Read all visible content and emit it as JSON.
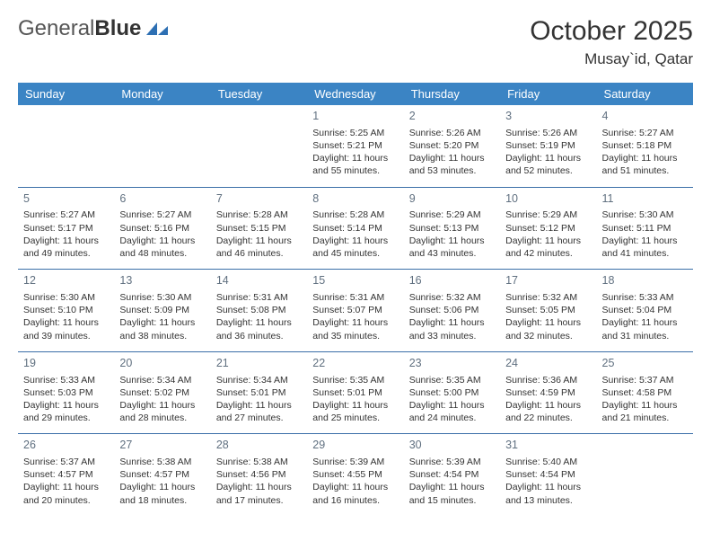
{
  "logo": {
    "word1": "General",
    "word2": "Blue"
  },
  "title": "October 2025",
  "location": "Musay`id, Qatar",
  "dayHeaders": [
    "Sunday",
    "Monday",
    "Tuesday",
    "Wednesday",
    "Thursday",
    "Friday",
    "Saturday"
  ],
  "weeks": [
    [
      null,
      null,
      null,
      {
        "n": "1",
        "sr": "5:25 AM",
        "ss": "5:21 PM",
        "dh": "11",
        "dm": "55"
      },
      {
        "n": "2",
        "sr": "5:26 AM",
        "ss": "5:20 PM",
        "dh": "11",
        "dm": "53"
      },
      {
        "n": "3",
        "sr": "5:26 AM",
        "ss": "5:19 PM",
        "dh": "11",
        "dm": "52"
      },
      {
        "n": "4",
        "sr": "5:27 AM",
        "ss": "5:18 PM",
        "dh": "11",
        "dm": "51"
      }
    ],
    [
      {
        "n": "5",
        "sr": "5:27 AM",
        "ss": "5:17 PM",
        "dh": "11",
        "dm": "49"
      },
      {
        "n": "6",
        "sr": "5:27 AM",
        "ss": "5:16 PM",
        "dh": "11",
        "dm": "48"
      },
      {
        "n": "7",
        "sr": "5:28 AM",
        "ss": "5:15 PM",
        "dh": "11",
        "dm": "46"
      },
      {
        "n": "8",
        "sr": "5:28 AM",
        "ss": "5:14 PM",
        "dh": "11",
        "dm": "45"
      },
      {
        "n": "9",
        "sr": "5:29 AM",
        "ss": "5:13 PM",
        "dh": "11",
        "dm": "43"
      },
      {
        "n": "10",
        "sr": "5:29 AM",
        "ss": "5:12 PM",
        "dh": "11",
        "dm": "42"
      },
      {
        "n": "11",
        "sr": "5:30 AM",
        "ss": "5:11 PM",
        "dh": "11",
        "dm": "41"
      }
    ],
    [
      {
        "n": "12",
        "sr": "5:30 AM",
        "ss": "5:10 PM",
        "dh": "11",
        "dm": "39"
      },
      {
        "n": "13",
        "sr": "5:30 AM",
        "ss": "5:09 PM",
        "dh": "11",
        "dm": "38"
      },
      {
        "n": "14",
        "sr": "5:31 AM",
        "ss": "5:08 PM",
        "dh": "11",
        "dm": "36"
      },
      {
        "n": "15",
        "sr": "5:31 AM",
        "ss": "5:07 PM",
        "dh": "11",
        "dm": "35"
      },
      {
        "n": "16",
        "sr": "5:32 AM",
        "ss": "5:06 PM",
        "dh": "11",
        "dm": "33"
      },
      {
        "n": "17",
        "sr": "5:32 AM",
        "ss": "5:05 PM",
        "dh": "11",
        "dm": "32"
      },
      {
        "n": "18",
        "sr": "5:33 AM",
        "ss": "5:04 PM",
        "dh": "11",
        "dm": "31"
      }
    ],
    [
      {
        "n": "19",
        "sr": "5:33 AM",
        "ss": "5:03 PM",
        "dh": "11",
        "dm": "29"
      },
      {
        "n": "20",
        "sr": "5:34 AM",
        "ss": "5:02 PM",
        "dh": "11",
        "dm": "28"
      },
      {
        "n": "21",
        "sr": "5:34 AM",
        "ss": "5:01 PM",
        "dh": "11",
        "dm": "27"
      },
      {
        "n": "22",
        "sr": "5:35 AM",
        "ss": "5:01 PM",
        "dh": "11",
        "dm": "25"
      },
      {
        "n": "23",
        "sr": "5:35 AM",
        "ss": "5:00 PM",
        "dh": "11",
        "dm": "24"
      },
      {
        "n": "24",
        "sr": "5:36 AM",
        "ss": "4:59 PM",
        "dh": "11",
        "dm": "22"
      },
      {
        "n": "25",
        "sr": "5:37 AM",
        "ss": "4:58 PM",
        "dh": "11",
        "dm": "21"
      }
    ],
    [
      {
        "n": "26",
        "sr": "5:37 AM",
        "ss": "4:57 PM",
        "dh": "11",
        "dm": "20"
      },
      {
        "n": "27",
        "sr": "5:38 AM",
        "ss": "4:57 PM",
        "dh": "11",
        "dm": "18"
      },
      {
        "n": "28",
        "sr": "5:38 AM",
        "ss": "4:56 PM",
        "dh": "11",
        "dm": "17"
      },
      {
        "n": "29",
        "sr": "5:39 AM",
        "ss": "4:55 PM",
        "dh": "11",
        "dm": "16"
      },
      {
        "n": "30",
        "sr": "5:39 AM",
        "ss": "4:54 PM",
        "dh": "11",
        "dm": "15"
      },
      {
        "n": "31",
        "sr": "5:40 AM",
        "ss": "4:54 PM",
        "dh": "11",
        "dm": "13"
      },
      null
    ]
  ],
  "labels": {
    "sunrise": "Sunrise: ",
    "sunset": "Sunset: ",
    "daylight1": "Daylight: ",
    "daylight2": " hours and ",
    "daylight3": " minutes."
  }
}
